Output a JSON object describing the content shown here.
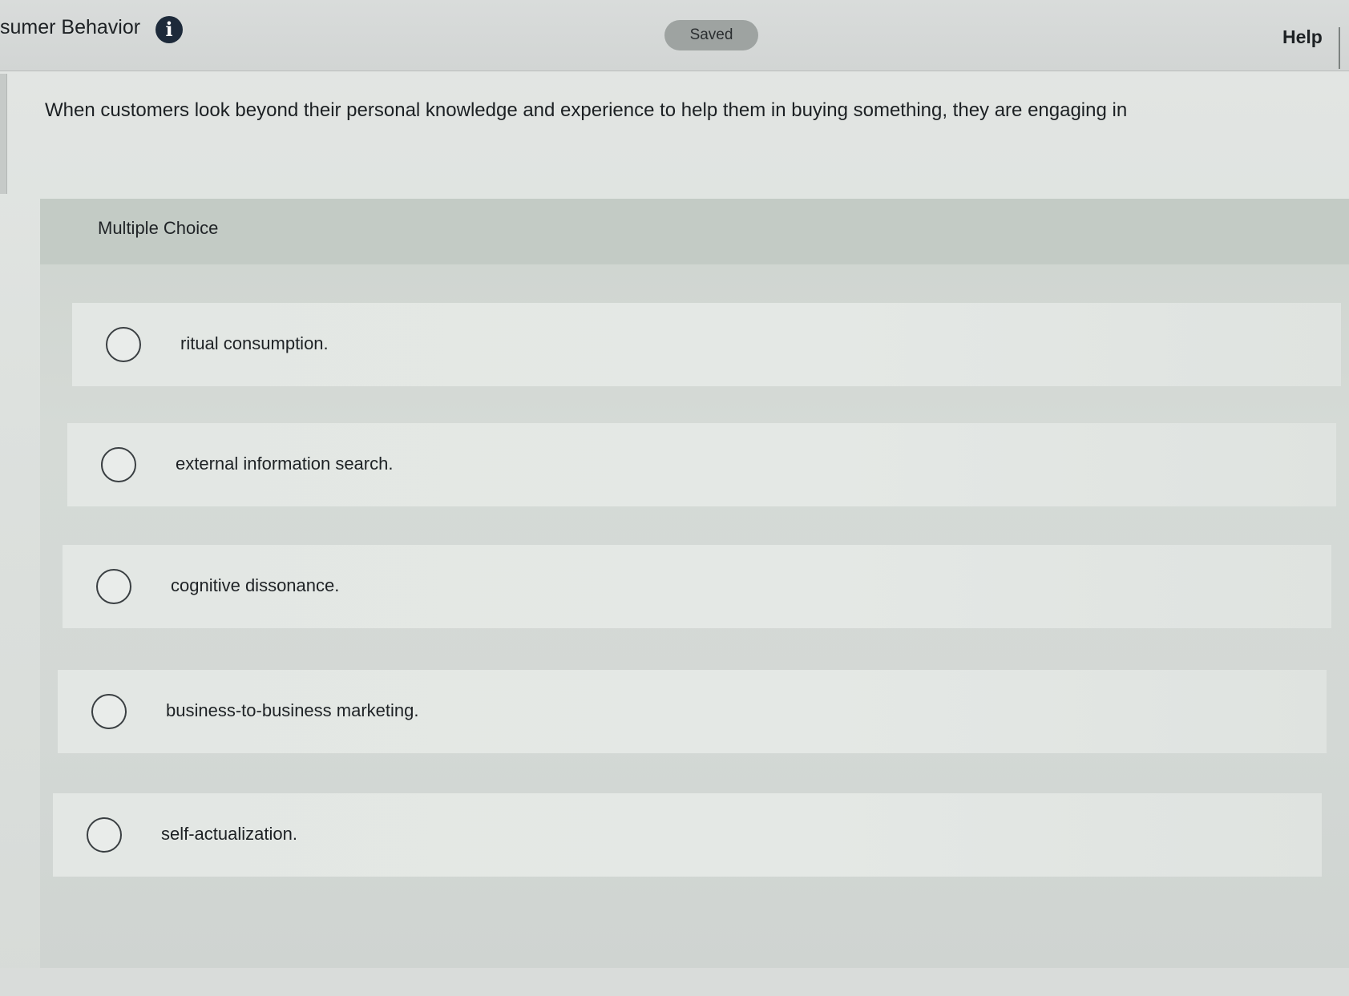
{
  "header": {
    "title": "sumer Behavior",
    "info_icon": "info-icon",
    "status_badge": "Saved",
    "help_label": "Help"
  },
  "question": {
    "text": "When customers look beyond their personal knowledge and experience to help them in buying something, they are engaging in"
  },
  "choices": {
    "section_label": "Multiple Choice",
    "options": [
      {
        "label": "ritual consumption.",
        "selected": false
      },
      {
        "label": "external information search.",
        "selected": false
      },
      {
        "label": "cognitive dissonance.",
        "selected": false
      },
      {
        "label": "business-to-business marketing.",
        "selected": false
      },
      {
        "label": "self-actualization.",
        "selected": false
      }
    ]
  },
  "colors": {
    "header_bg": "#d2d5d4",
    "info_icon_bg": "#1d2a3a",
    "saved_pill_bg": "#9ea3a1",
    "panel_header_bg": "#c3cbc5",
    "option_bg": "#e3e7e4"
  }
}
